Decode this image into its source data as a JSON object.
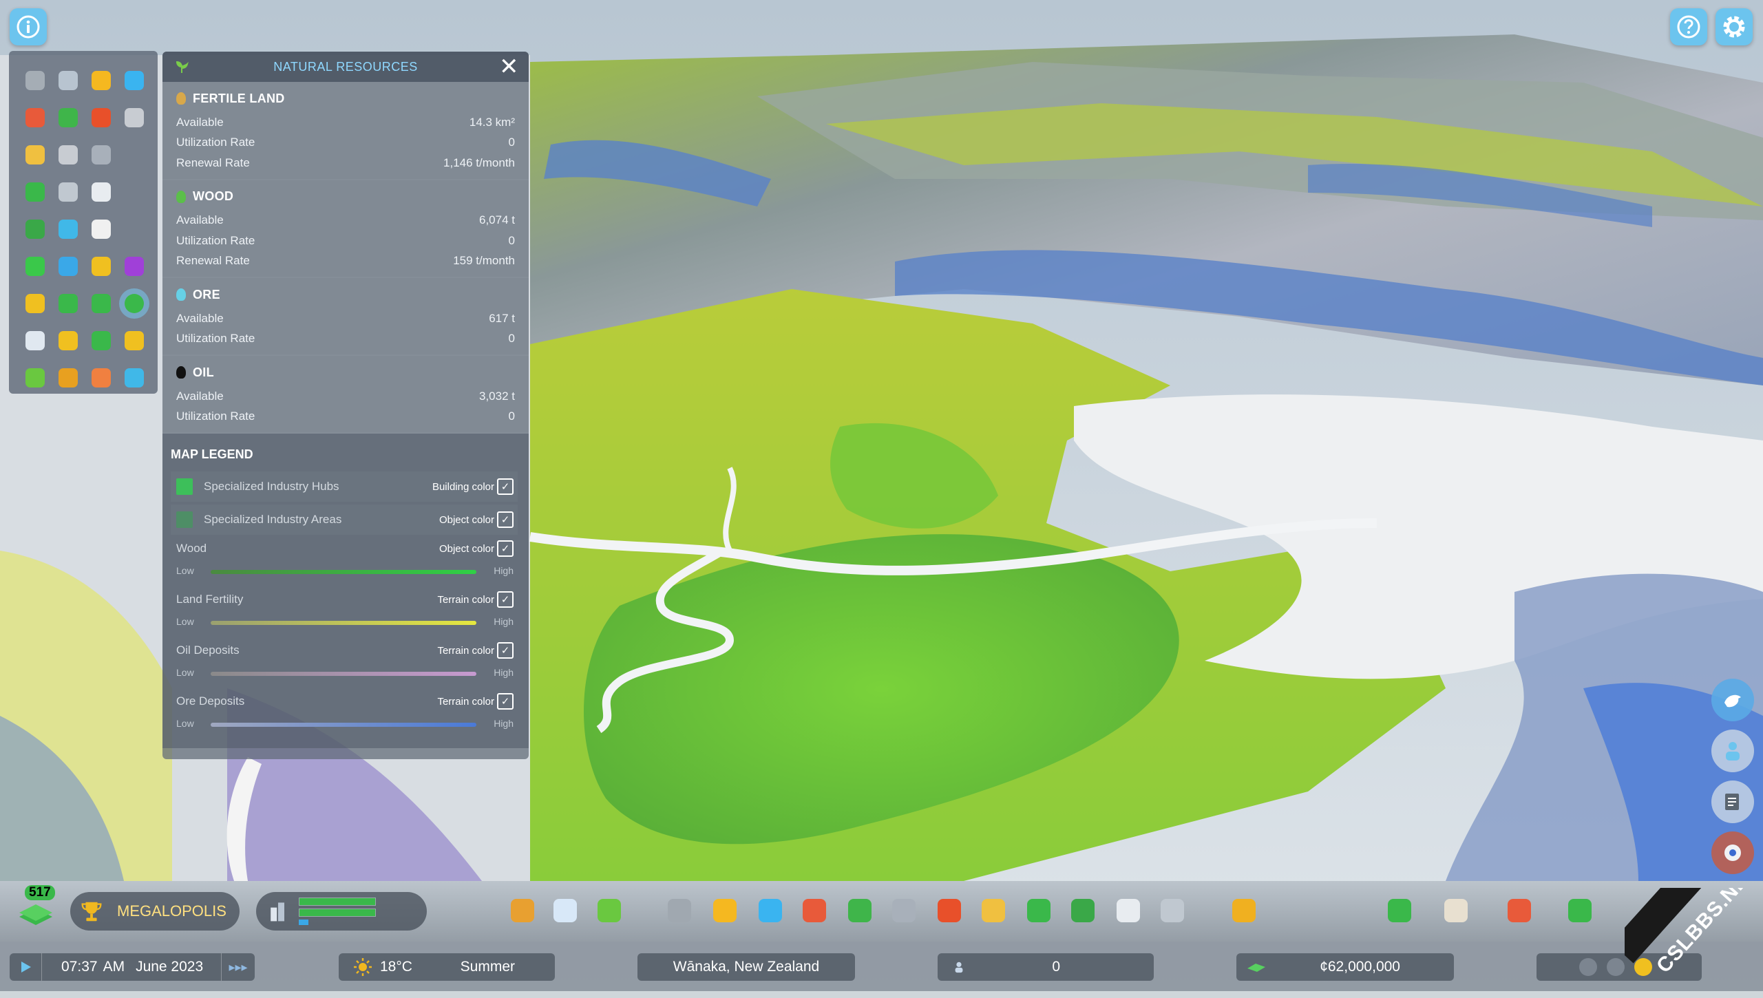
{
  "panel": {
    "title": "NATURAL RESOURCES",
    "resources": [
      {
        "name": "FERTILE LAND",
        "icon": "wheat-icon",
        "color": "#d8a84a",
        "rows": [
          {
            "label": "Available",
            "value": "14.3 km²"
          },
          {
            "label": "Utilization Rate",
            "value": "0"
          },
          {
            "label": "Renewal Rate",
            "value": "1,146 t/month"
          }
        ]
      },
      {
        "name": "WOOD",
        "icon": "tree-icon",
        "color": "#5bbf4a",
        "rows": [
          {
            "label": "Available",
            "value": "6,074 t"
          },
          {
            "label": "Utilization Rate",
            "value": "0"
          },
          {
            "label": "Renewal Rate",
            "value": "159 t/month"
          }
        ]
      },
      {
        "name": "ORE",
        "icon": "ore-icon",
        "color": "#66d0e6",
        "rows": [
          {
            "label": "Available",
            "value": "617 t"
          },
          {
            "label": "Utilization Rate",
            "value": "0"
          }
        ]
      },
      {
        "name": "OIL",
        "icon": "oil-drop-icon",
        "color": "#111111",
        "rows": [
          {
            "label": "Available",
            "value": "3,032 t"
          },
          {
            "label": "Utilization Rate",
            "value": "0"
          }
        ]
      }
    ],
    "legend": {
      "title": "MAP LEGEND",
      "items": [
        {
          "name": "Specialized Industry Hubs",
          "mode": "Building color",
          "color": "#3dbf5a"
        },
        {
          "name": "Specialized Industry Areas",
          "mode": "Object color",
          "color": "#4e8e66"
        }
      ],
      "gradients": [
        {
          "name": "Wood",
          "mode": "Object color",
          "low": "Low",
          "high": "High",
          "from": "#4a8a40",
          "to": "#2fd045"
        },
        {
          "name": "Land Fertility",
          "mode": "Terrain color",
          "low": "Low",
          "high": "High",
          "from": "#9aa070",
          "to": "#e6e840"
        },
        {
          "name": "Oil Deposits",
          "mode": "Terrain color",
          "low": "Low",
          "high": "High",
          "from": "#8a8a8a",
          "to": "#c79ad0"
        },
        {
          "name": "Ore Deposits",
          "mode": "Terrain color",
          "low": "Low",
          "high": "High",
          "from": "#a0a8c0",
          "to": "#4a7ad8"
        }
      ]
    }
  },
  "infoviews": [
    "road-icon",
    "vehicle-icon",
    "electricity-icon",
    "water-icon",
    "health-icon",
    "recycle-icon",
    "fire-icon",
    "wrench-icon",
    "police-icon",
    "government-icon",
    "education-icon",
    "",
    "transport-icon",
    "mail-icon",
    "chat-icon",
    "",
    "parks-icon",
    "tourism-icon",
    "pollution-icon",
    "",
    "residential-zone-icon",
    "commercial-zone-icon",
    "industrial-zone-icon",
    "office-zone-icon",
    "house-icon",
    "land-value-icon",
    "economy-icon",
    "natural-resources-icon",
    "population-icon",
    "happiness-icon",
    "money-icon",
    "workers-icon",
    "terrain-icon",
    "goods-icon",
    "services-icon",
    "water-zone-icon"
  ],
  "infoview_colors": [
    "#a5adb5",
    "#b8c4d0",
    "#f5b820",
    "#3ab4f0",
    "#e85a3a",
    "#3fb54a",
    "#e8502a",
    "#c8ccd2",
    "#f0c040",
    "#c8ccd2",
    "#a8b0ba",
    "",
    "#3ab84a",
    "#c0c8d0",
    "#e8ecf0",
    "",
    "#3aa848",
    "#40b8e8",
    "#f0f0f0",
    "",
    "#3ac84a",
    "#3aa8e8",
    "#f0c020",
    "#a040d8",
    "#f0c020",
    "#3ab84a",
    "#3ab84a",
    "#3ab84a",
    "#e0e8f0",
    "#f0c020",
    "#3ab84a",
    "#f0c020",
    "#6ac840",
    "#e8a020",
    "#f08040",
    "#40b8e8"
  ],
  "achievement": {
    "count": "517",
    "milestone": "MEGALOPOLIS"
  },
  "status": {
    "time": "07:37",
    "ampm": "AM",
    "date": "June 2023",
    "temperature": "18°C",
    "season": "Summer",
    "location": "Wānaka, New Zealand",
    "population": "0",
    "money": "¢62,000,000"
  },
  "watermark": "CSLBBS.NET",
  "colors": {
    "accent": "#6cc4ee",
    "panel_title": "#8fd8ff",
    "resource_bar_green": "#3dbf5a"
  }
}
